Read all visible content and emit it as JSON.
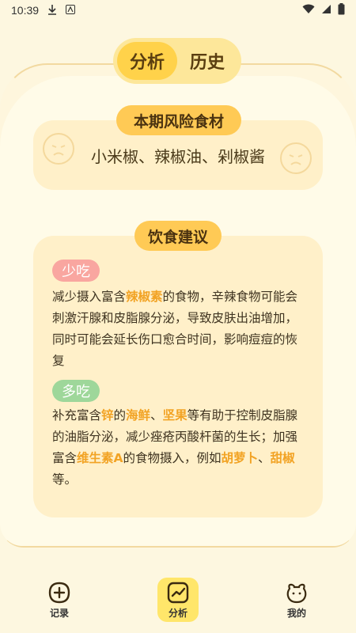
{
  "status_bar": {
    "time": "10:39"
  },
  "tabs": [
    {
      "label": "分析",
      "active": true
    },
    {
      "label": "历史",
      "active": false
    }
  ],
  "risk_section": {
    "header": "本期风险食材",
    "foods_text": "小米椒、辣椒油、剁椒酱"
  },
  "advice_section": {
    "header": "饮食建议",
    "less": {
      "tag": "少吃",
      "text_parts": [
        {
          "t": "减少摄入富含",
          "hl": false
        },
        {
          "t": "辣椒素",
          "hl": true
        },
        {
          "t": "的食物，辛辣食物可能会刺激汗腺和皮脂腺分泌，导致皮肤出油增加，同时可能会延长伤口愈合时间，影响痘痘的恢复",
          "hl": false
        }
      ]
    },
    "more": {
      "tag": "多吃",
      "text_parts": [
        {
          "t": "补充富含",
          "hl": false
        },
        {
          "t": "锌",
          "hl": true
        },
        {
          "t": "的",
          "hl": false
        },
        {
          "t": "海鲜",
          "hl": true
        },
        {
          "t": "、",
          "hl": false
        },
        {
          "t": "坚果",
          "hl": true
        },
        {
          "t": "等有助于控制皮脂腺的油脂分泌，减少痤疮丙酸杆菌的生长；加强富含",
          "hl": false
        },
        {
          "t": "维生素A",
          "hl": true
        },
        {
          "t": "的食物摄入，例如",
          "hl": false
        },
        {
          "t": "胡萝卜",
          "hl": true
        },
        {
          "t": "、",
          "hl": false
        },
        {
          "t": "甜椒",
          "hl": true
        },
        {
          "t": "等。",
          "hl": false
        }
      ]
    }
  },
  "bottom_nav": [
    {
      "label": "记录",
      "icon": "plus-square-icon",
      "active": false
    },
    {
      "label": "分析",
      "icon": "chart-icon",
      "active": true
    },
    {
      "label": "我的",
      "icon": "bear-face-icon",
      "active": false
    }
  ],
  "colors": {
    "background": "#fdf7e0",
    "accent": "#ffd24a",
    "highlight": "#f2a324",
    "less_tag": "#f9a6a0",
    "more_tag": "#9ed79a"
  }
}
